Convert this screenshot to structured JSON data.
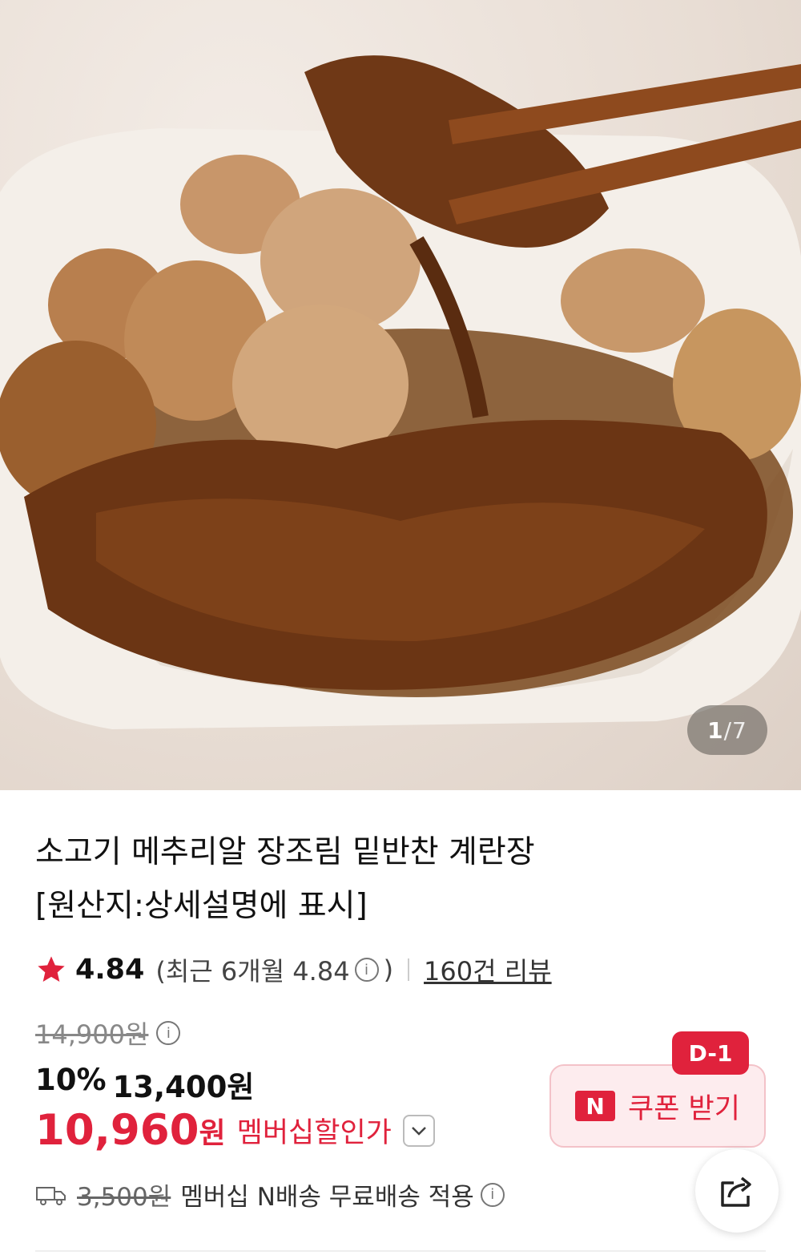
{
  "gallery": {
    "current": "1",
    "separator": "/",
    "total": "7",
    "image": "beef-quail-egg-jangjorim-photo"
  },
  "product": {
    "title_line1": "소고기 메추리알 장조림 밑반찬 계란장",
    "title_line2": "[원산지:상세설명에 표시]"
  },
  "rating": {
    "score": "4.84",
    "recent_prefix": "(최근 6개월 4.84",
    "recent_suffix": ")",
    "review_link": "160건 리뷰"
  },
  "price": {
    "original": "14,900원",
    "discount_pct": "10%",
    "discounted": "13,400원",
    "member_price": "10,960",
    "member_won": "원",
    "member_label": "멤버십할인가"
  },
  "shipping": {
    "old_fee": "3,500원",
    "text": "멤버십 N배송 무료배송 적용"
  },
  "coupon": {
    "dday": "D-1",
    "n_logo": "N",
    "label": "쿠폰 받기"
  },
  "colors": {
    "accent": "#e0223c",
    "coupon_bg": "#fdecee"
  },
  "icons": [
    "star-icon",
    "info-icon",
    "chevron-down-icon",
    "truck-icon",
    "share-icon"
  ]
}
